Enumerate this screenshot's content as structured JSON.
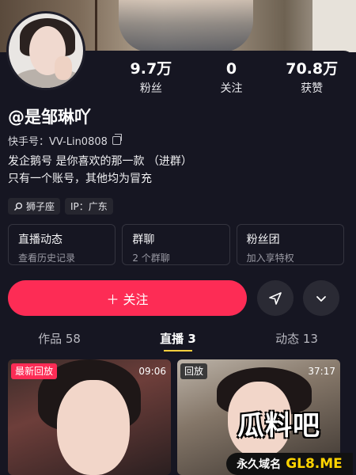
{
  "stats": [
    {
      "value": "9.7万",
      "label": "粉丝"
    },
    {
      "value": "0",
      "label": "关注"
    },
    {
      "value": "70.8万",
      "label": "获赞"
    }
  ],
  "profile": {
    "name": "@是邹琳吖",
    "uid": "快手号：VV-Lin0808",
    "bio_line1": "发企鹅号 是你喜欢的那一款 （进群）",
    "bio_line2": "只有一个账号，其他均为冒充"
  },
  "tags": {
    "zodiac": "狮子座",
    "ip": "IP：广东"
  },
  "cards": [
    {
      "title": "直播动态",
      "sub": "查看历史记录"
    },
    {
      "title": "群聊",
      "sub": "2 个群聊"
    },
    {
      "title": "粉丝团",
      "sub": "加入享特权"
    }
  ],
  "actions": {
    "follow_label": "＋ 关注"
  },
  "tabs": [
    {
      "label": "作品 58"
    },
    {
      "label": "直播 3"
    },
    {
      "label": "动态 13"
    }
  ],
  "thumbs": [
    {
      "badge": "最新回放",
      "duration": "09:06",
      "badge_color": "#fd2c55"
    },
    {
      "badge": "回放",
      "duration": "37:17",
      "badge_color": "#3a3a3a"
    }
  ],
  "watermark": {
    "title": "瓜料吧",
    "left": "永久域名",
    "domain": "GL8.ME"
  }
}
